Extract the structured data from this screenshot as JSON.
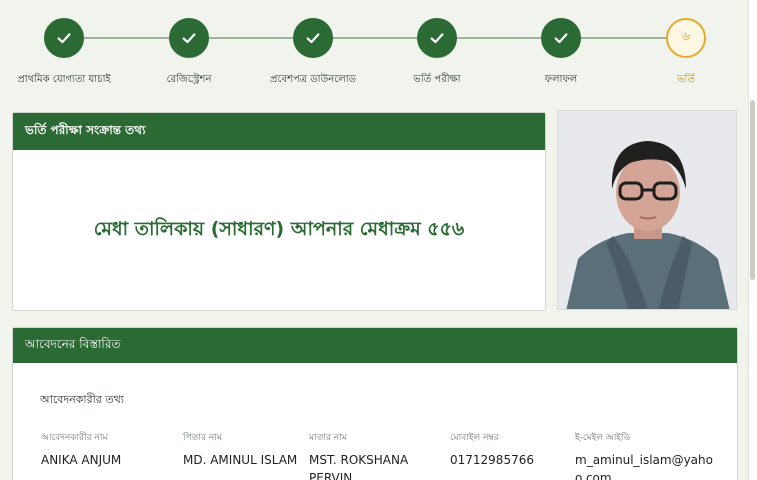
{
  "stepper": {
    "steps": [
      {
        "label": "প্রাথমিক যোগ্যতা যাচাই",
        "status": "done"
      },
      {
        "label": "রেজিস্ট্রেশন",
        "status": "done"
      },
      {
        "label": "প্রবেশপত্র ডাউনলোড",
        "status": "done"
      },
      {
        "label": "ভর্তি পরীক্ষা",
        "status": "done"
      },
      {
        "label": "ফলাফল",
        "status": "done"
      },
      {
        "label": "ভর্তি",
        "status": "current",
        "number": "৬"
      }
    ]
  },
  "exam_info": {
    "header": "ভর্তি পরীক্ষা সংক্রান্ত তথ্য",
    "merit_text": "মেধা তালিকায় (সাধারণ) আপনার মেধাক্রম ৫৫৬"
  },
  "photo": {
    "alt": "applicant-photo"
  },
  "application": {
    "header": "আবেদনের বিস্তারিত",
    "section_title": "আবেদনকারীর তথ্য",
    "fields": [
      {
        "label": "আবেদনকারীর নাম",
        "value": "ANIKA ANJUM"
      },
      {
        "label": "পিতার নাম",
        "value": "MD. AMINUL ISLAM"
      },
      {
        "label": "মাতার নাম",
        "value": "MST. ROKSHANA PERVIN"
      },
      {
        "label": "মোবাইল নম্বর",
        "value": "01712985766"
      },
      {
        "label": "ই-মেইল আইডি",
        "value": "m_aminul_islam@yahoo.com"
      }
    ]
  },
  "colors": {
    "primary_green": "#2c6a35",
    "current_step": "#e3ab2e",
    "background": "#f1f4ec"
  }
}
